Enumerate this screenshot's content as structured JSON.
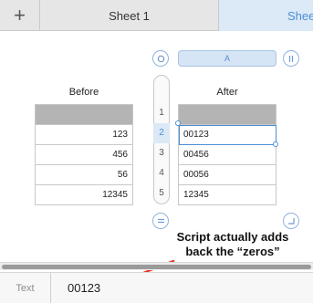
{
  "tabs": {
    "add_label": "+",
    "sheet1": "Sheet 1",
    "sheet2": "Shee"
  },
  "column_header": {
    "label": "A"
  },
  "row_headers": [
    "1",
    "2",
    "3",
    "4",
    "5"
  ],
  "before": {
    "title": "Before",
    "values": [
      "123",
      "456",
      "56",
      "12345"
    ]
  },
  "after": {
    "title": "After",
    "values": [
      "00123",
      "00456",
      "00056",
      "12345"
    ]
  },
  "annotation": {
    "line1": "Script actually adds",
    "line2": "back the “zeros”"
  },
  "formula_bar": {
    "label": "Text",
    "value": "00123"
  },
  "colors": {
    "accent": "#4a8fd6",
    "header_fill": "#b4b4b4",
    "arrow": "#e8352a"
  }
}
